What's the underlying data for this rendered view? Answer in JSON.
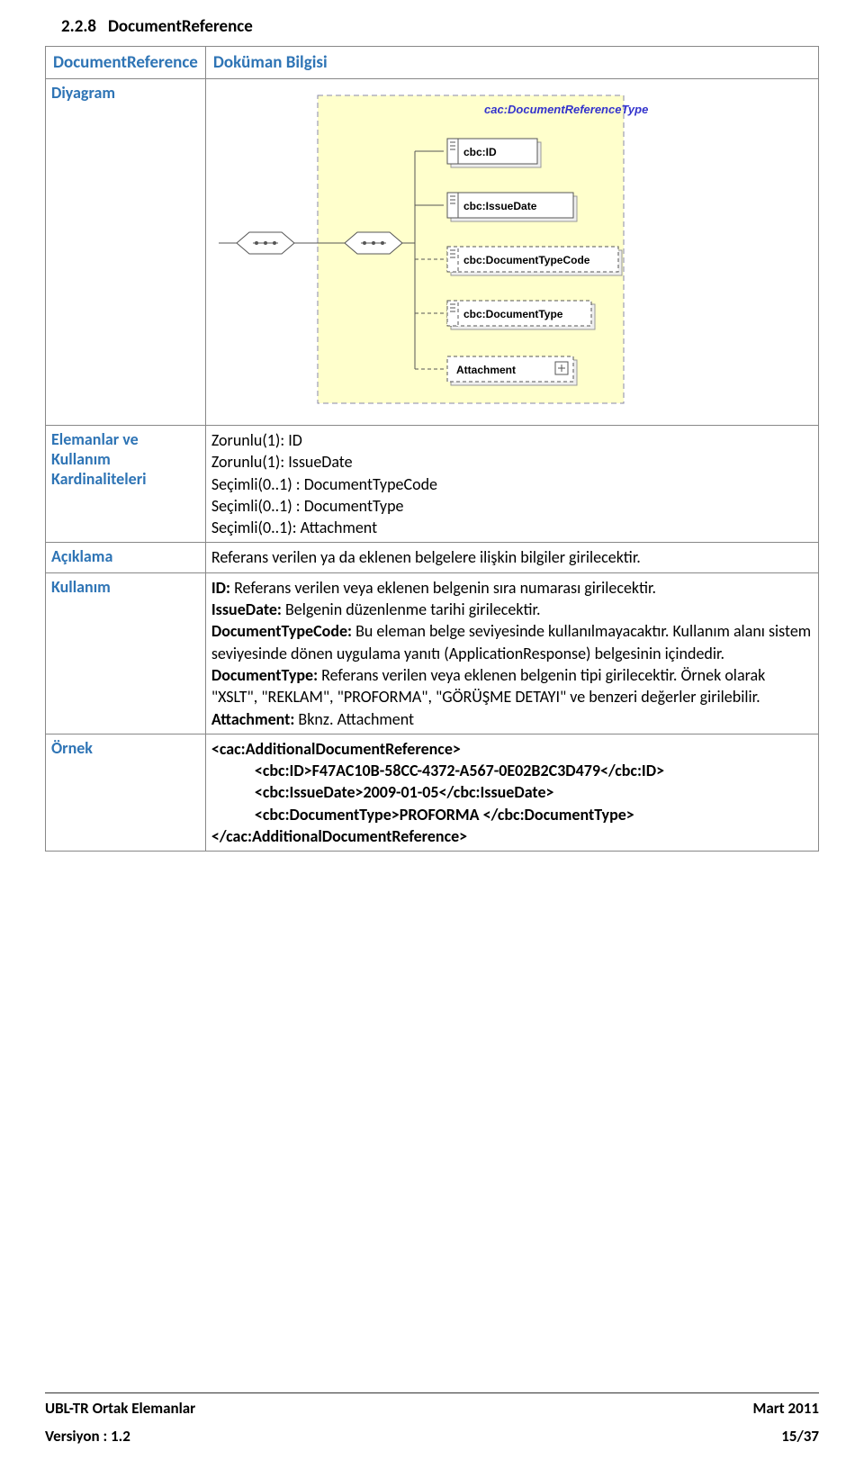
{
  "section": {
    "number": "2.2.8",
    "title": "DocumentReference"
  },
  "tableHeader": {
    "left": "DocumentReference",
    "right": "Doküman Bilgisi"
  },
  "rows": {
    "diagramLabel": "Diyagram",
    "elementsLabel1": "Elemanlar ve",
    "elementsLabel2": "Kullanım",
    "elementsLabel3": "Kardinaliteleri",
    "aciklamaLabel": "Açıklama",
    "kullanimLabel": "Kullanım",
    "ornekLabel": "Örnek"
  },
  "elements": {
    "line1": "Zorunlu(1): ID",
    "line2": "Zorunlu(1): IssueDate",
    "line3": "Seçimli(0..1) : DocumentTypeCode",
    "line4": "Seçimli(0..1) : DocumentType",
    "line5": "Seçimli(0..1): Attachment"
  },
  "aciklama": "Referans verilen ya da eklenen belgelere ilişkin bilgiler girilecektir.",
  "kullanim": {
    "p1a": "ID:",
    "p1b": " Referans verilen veya eklenen belgenin sıra numarası girilecektir.",
    "p2a": "IssueDate:",
    "p2b": " Belgenin düzenlenme tarihi girilecektir.",
    "p3a": "DocumentTypeCode:",
    "p3b": " Bu eleman belge seviyesinde kullanılmayacaktır. Kullanım alanı sistem seviyesinde dönen uygulama yanıtı (ApplicationResponse) belgesinin içindedir.",
    "p4a": "DocumentType:",
    "p4b": " Referans verilen veya eklenen belgenin tipi girilecektir. Örnek olarak \"XSLT\", \"REKLAM\", \"PROFORMA\", \"GÖRÜŞME DETAYI\" ve benzeri değerler girilebilir.",
    "p5a": "Attachment:",
    "p5b": " Bknz. Attachment"
  },
  "example": {
    "l1": "<cac:AdditionalDocumentReference>",
    "l2": "<cbc:ID>F47AC10B-58CC-4372-A567-0E02B2C3D479</cbc:ID>",
    "l3": "<cbc:IssueDate>2009-01-05</cbc:IssueDate>",
    "l4": "<cbc:DocumentType>PROFORMA </cbc:DocumentType>",
    "l5": "</cac:AdditionalDocumentReference>"
  },
  "diagram": {
    "title": "cac:DocumentReferenceType",
    "nodes": {
      "id": "cbc:ID",
      "issueDate": "cbc:IssueDate",
      "docTypeCode": "cbc:DocumentTypeCode",
      "docType": "cbc:DocumentType",
      "attachment": "Attachment"
    }
  },
  "footer": {
    "leftTop": "UBL-TR Ortak Elemanlar",
    "rightTop": "Mart 2011",
    "leftBottom": "Versiyon : 1.2",
    "rightBottom": "15/37"
  }
}
